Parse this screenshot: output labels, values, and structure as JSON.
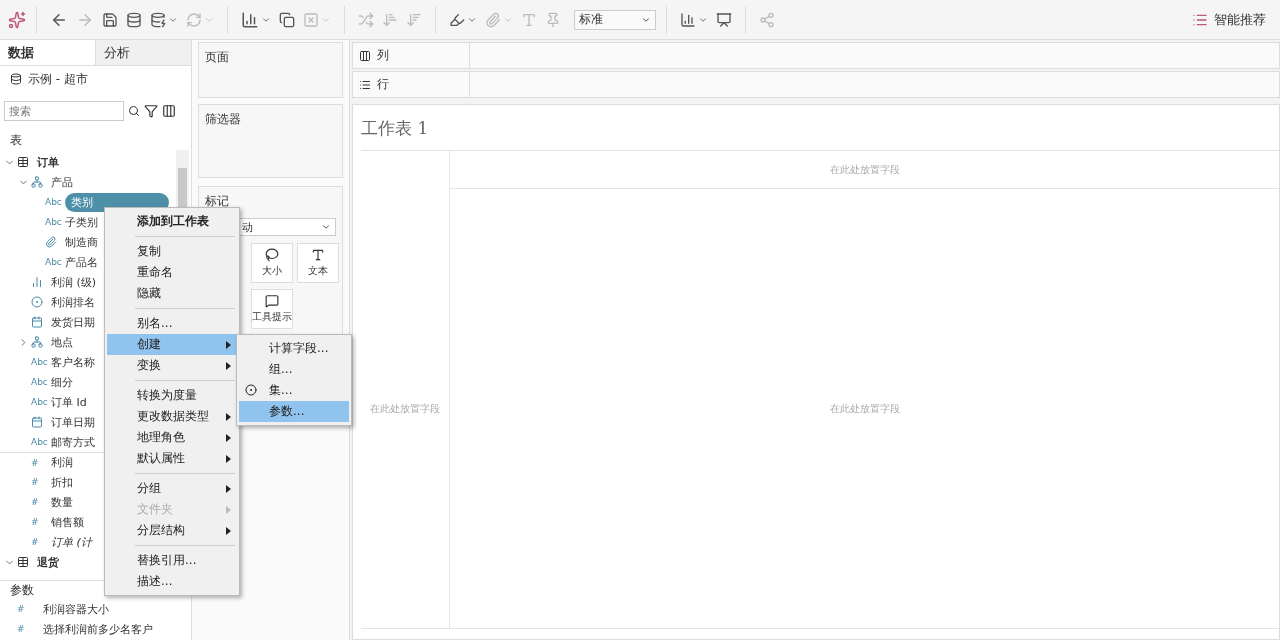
{
  "toolbar": {
    "view_size": "标准",
    "show_me": "智能推荐"
  },
  "data_pane": {
    "tabs": [
      {
        "label": "数据",
        "selected": true
      },
      {
        "label": "分析",
        "selected": false
      }
    ],
    "datasource": "示例 - 超市",
    "search": {
      "placeholder": "搜索"
    },
    "tables_heading": "表",
    "tree": [
      {
        "label": "订单",
        "kind": "table",
        "expanded": true,
        "selected": false,
        "children": [
          {
            "label": "产品",
            "kind": "hierarchy",
            "expanded": true,
            "selected": false,
            "children": [
              {
                "label": "类别",
                "kind": "abc",
                "badge": "Abc",
                "selected": true
              },
              {
                "label": "子类别",
                "kind": "abc",
                "badge": "Abc",
                "selected": false
              },
              {
                "label": "制造商",
                "kind": "clip",
                "selected": false
              },
              {
                "label": "产品名",
                "kind": "abc",
                "badge": "Abc",
                "selected": false
              }
            ]
          },
          {
            "label": "利润 (级)",
            "kind": "bin",
            "selected": false
          },
          {
            "label": "利润排名",
            "kind": "set",
            "selected": false
          },
          {
            "label": "发货日期",
            "kind": "date",
            "selected": false
          },
          {
            "label": "地点",
            "kind": "hierarchy",
            "expanded": false,
            "selected": false
          },
          {
            "label": "客户名称",
            "kind": "abc",
            "badge": "Abc",
            "selected": false
          },
          {
            "label": "细分",
            "kind": "abc",
            "badge": "Abc",
            "selected": false
          },
          {
            "label": "订单 Id",
            "kind": "abc",
            "badge": "Abc",
            "selected": false
          },
          {
            "label": "订单日期",
            "kind": "date",
            "selected": false
          },
          {
            "label": "邮寄方式",
            "kind": "abc",
            "badge": "Abc",
            "selected": false
          },
          {
            "label": "利润",
            "kind": "measure",
            "badge": "#",
            "selected": false
          },
          {
            "label": "折扣",
            "kind": "measure",
            "badge": "#",
            "selected": false
          },
          {
            "label": "数量",
            "kind": "measure",
            "badge": "#",
            "selected": false
          },
          {
            "label": "销售额",
            "kind": "measure",
            "badge": "#",
            "selected": false
          },
          {
            "label": "订单 (计",
            "kind": "measure",
            "badge": "#",
            "italic": true,
            "selected": false
          }
        ]
      },
      {
        "label": "退货",
        "kind": "table",
        "expanded": true,
        "selected": false
      }
    ],
    "parameters_heading": "参数",
    "parameters": [
      {
        "label": "利润容器大小",
        "badge": "#"
      },
      {
        "label": "选择利润前多少名客户",
        "badge": "#"
      }
    ]
  },
  "shelves": {
    "pages": "页面",
    "filters": "筛选器",
    "marks": {
      "title": "标记",
      "mark_type": "动",
      "cards": [
        "大小",
        "文本",
        "工具提示"
      ]
    },
    "columns": "列",
    "rows": "行"
  },
  "worksheet": {
    "title": "工作表 1",
    "drop_top": "在此处放置字段",
    "drop_left": "在此处放置字段",
    "drop_center": "在此处放置字段"
  },
  "context_menu": {
    "groups": [
      [
        {
          "label": "添加到工作表",
          "emphasized": true,
          "submenu": false,
          "disabled": false,
          "selected": false
        }
      ],
      [
        {
          "label": "复制",
          "submenu": false,
          "disabled": false,
          "selected": false
        },
        {
          "label": "重命名",
          "submenu": false,
          "disabled": false,
          "selected": false
        },
        {
          "label": "隐藏",
          "submenu": false,
          "disabled": false,
          "selected": false
        }
      ],
      [
        {
          "label": "别名...",
          "submenu": false,
          "disabled": false,
          "selected": false
        },
        {
          "label": "创建",
          "submenu": true,
          "disabled": false,
          "selected": true
        },
        {
          "label": "变换",
          "submenu": true,
          "disabled": false,
          "selected": false
        }
      ],
      [
        {
          "label": "转换为度量",
          "submenu": false,
          "disabled": false,
          "selected": false
        },
        {
          "label": "更改数据类型",
          "submenu": true,
          "disabled": false,
          "selected": false
        },
        {
          "label": "地理角色",
          "submenu": true,
          "disabled": false,
          "selected": false
        },
        {
          "label": "默认属性",
          "submenu": true,
          "disabled": false,
          "selected": false
        }
      ],
      [
        {
          "label": "分组",
          "submenu": true,
          "disabled": false,
          "selected": false
        },
        {
          "label": "文件夹",
          "submenu": true,
          "disabled": true,
          "selected": false
        },
        {
          "label": "分层结构",
          "submenu": true,
          "disabled": false,
          "selected": false
        }
      ],
      [
        {
          "label": "替换引用...",
          "submenu": false,
          "disabled": false,
          "selected": false
        },
        {
          "label": "描述...",
          "submenu": false,
          "disabled": false,
          "selected": false
        }
      ]
    ]
  },
  "submenu": [
    {
      "label": "计算字段...",
      "kind": "plain",
      "selected": false
    },
    {
      "label": "组...",
      "kind": "plain",
      "selected": false
    },
    {
      "label": "集...",
      "kind": "set",
      "selected": false
    },
    {
      "label": "参数...",
      "kind": "plain",
      "selected": true
    }
  ]
}
